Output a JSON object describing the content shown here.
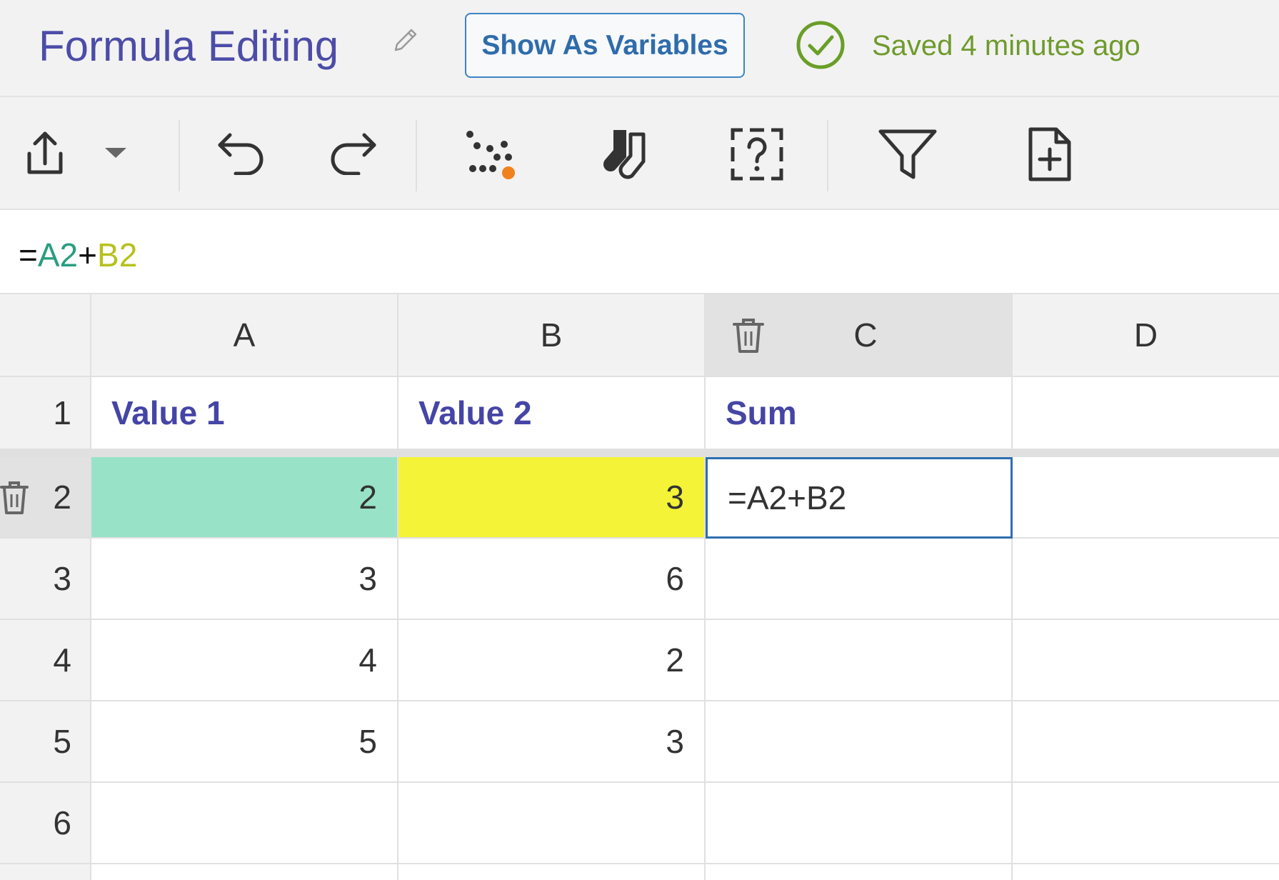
{
  "header": {
    "title": "Formula Editing",
    "show_variables_label": "Show As Variables",
    "saved_status": "Saved 4 minutes ago"
  },
  "toolbar": {
    "icons": [
      "export-icon",
      "dropdown-caret-icon",
      "undo-icon",
      "redo-icon",
      "scatter-icon",
      "socks-icon",
      "question-box-icon",
      "filter-icon",
      "add-file-icon"
    ]
  },
  "formula_bar": {
    "eq": "=",
    "ref_a": "A2",
    "op": "+",
    "ref_b": "B2"
  },
  "columns": [
    "A",
    "B",
    "C",
    "D"
  ],
  "rows": [
    "1",
    "2",
    "3",
    "4",
    "5",
    "6"
  ],
  "cells": {
    "A1": "Value 1",
    "B1": "Value 2",
    "C1": "Sum",
    "A2": "2",
    "B2": "3",
    "C2": "=A2+B2",
    "A3": "3",
    "B3": "6",
    "A4": "4",
    "B4": "2",
    "A5": "5",
    "B5": "3"
  },
  "colors": {
    "title": "#4c4ca8",
    "accent_blue": "#2f6cab",
    "saved_green": "#6f9a2c",
    "ref_a_color": "#2a9d80",
    "ref_b_color": "#b7c11c",
    "cell_a2_fill": "#98e3c8",
    "cell_b2_fill": "#f4f338"
  }
}
